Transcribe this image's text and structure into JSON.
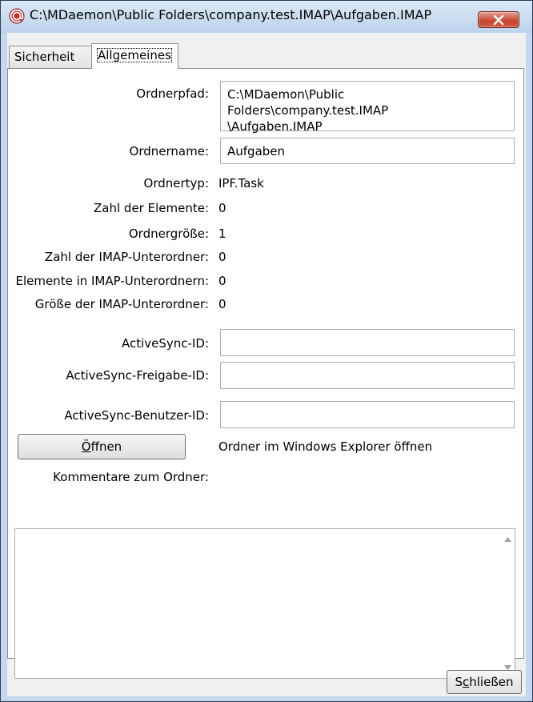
{
  "window": {
    "title": "C:\\MDaemon\\Public Folders\\company.test.IMAP\\Aufgaben.IMAP"
  },
  "tabs": [
    {
      "label": "Sicherheit",
      "active": false
    },
    {
      "label": "Allgemeines",
      "active": true
    }
  ],
  "fields": {
    "path_label": "Ordnerpfad:",
    "path_value": "C:\\MDaemon\\Public Folders\\company.test.IMAP\n\\Aufgaben.IMAP",
    "name_label": "Ordnername:",
    "name_value": "Aufgaben"
  },
  "info": [
    {
      "label": "Ordnertyp:",
      "value": "IPF.Task"
    },
    {
      "label": "Zahl der Elemente:",
      "value": "0"
    },
    {
      "label": "Ordnergröße:",
      "value": "1"
    },
    {
      "label": "Zahl der IMAP-Unterordner:",
      "value": "0"
    },
    {
      "label": "Elemente in IMAP-Unterordnern:",
      "value": "0"
    },
    {
      "label": "Größe der IMAP-Unterordner:",
      "value": "0"
    }
  ],
  "activesync": {
    "id_label": "ActiveSync-ID:",
    "id_value": "",
    "share_label": "ActiveSync-Freigabe-ID:",
    "share_value": "",
    "user_label": "ActiveSync-Benutzer-ID:",
    "user_value": ""
  },
  "open": {
    "button_label_rest": "ffnen",
    "button_mnemonic": "Ö",
    "description": "Ordner im Windows Explorer öffnen"
  },
  "comments": {
    "label": "Kommentare zum Ordner:",
    "value": ""
  },
  "footer": {
    "close_mnemonic": "c",
    "close_pre": "S",
    "close_post": "hließen"
  },
  "colors": {
    "frame": "#c5d7ec",
    "close_button": "#c7442f",
    "panel_bg": "#ffffff",
    "dialog_bg": "#f0f0f0"
  }
}
